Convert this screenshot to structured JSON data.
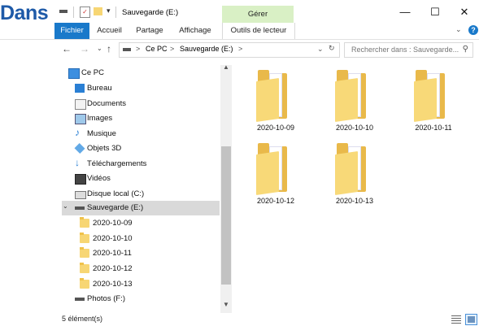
{
  "overlay_text": "Dans",
  "window": {
    "title": "Sauvegarde (E:)",
    "contextual_tab": "Gérer",
    "controls": {
      "minimize": "—",
      "maximize": "☐",
      "close": "✕"
    }
  },
  "ribbon": {
    "tabs": [
      "Fichier",
      "Accueil",
      "Partage",
      "Affichage",
      "Outils de lecteur"
    ],
    "help": "?"
  },
  "address": {
    "segments": [
      "Ce PC",
      "Sauvegarde (E:)"
    ],
    "separator": ">",
    "search_placeholder": "Rechercher dans : Sauvegarde..."
  },
  "sidebar": {
    "items": [
      {
        "label": "Ce PC",
        "icon": "computer-icon"
      },
      {
        "label": "Bureau",
        "icon": "desktop-icon"
      },
      {
        "label": "Documents",
        "icon": "documents-icon"
      },
      {
        "label": "Images",
        "icon": "images-icon"
      },
      {
        "label": "Musique",
        "icon": "music-icon"
      },
      {
        "label": "Objets 3D",
        "icon": "objects3d-icon"
      },
      {
        "label": "Téléchargements",
        "icon": "downloads-icon"
      },
      {
        "label": "Vidéos",
        "icon": "videos-icon"
      },
      {
        "label": "Disque local (C:)",
        "icon": "drive-icon"
      },
      {
        "label": "Sauvegarde (E:)",
        "icon": "drive-icon",
        "selected": true
      },
      {
        "label": "2020-10-09",
        "icon": "folder-icon"
      },
      {
        "label": "2020-10-10",
        "icon": "folder-icon"
      },
      {
        "label": "2020-10-11",
        "icon": "folder-icon"
      },
      {
        "label": "2020-10-12",
        "icon": "folder-icon"
      },
      {
        "label": "2020-10-13",
        "icon": "folder-icon"
      },
      {
        "label": "Photos (F:)",
        "icon": "drive-icon"
      }
    ]
  },
  "content": {
    "folders": [
      "2020-10-09",
      "2020-10-10",
      "2020-10-11",
      "2020-10-12",
      "2020-10-13"
    ]
  },
  "status": {
    "count": "5 élément(s)"
  },
  "colors": {
    "accent": "#1979ca",
    "manage_tab": "#d9f0c5",
    "folder": "#f7d674"
  }
}
